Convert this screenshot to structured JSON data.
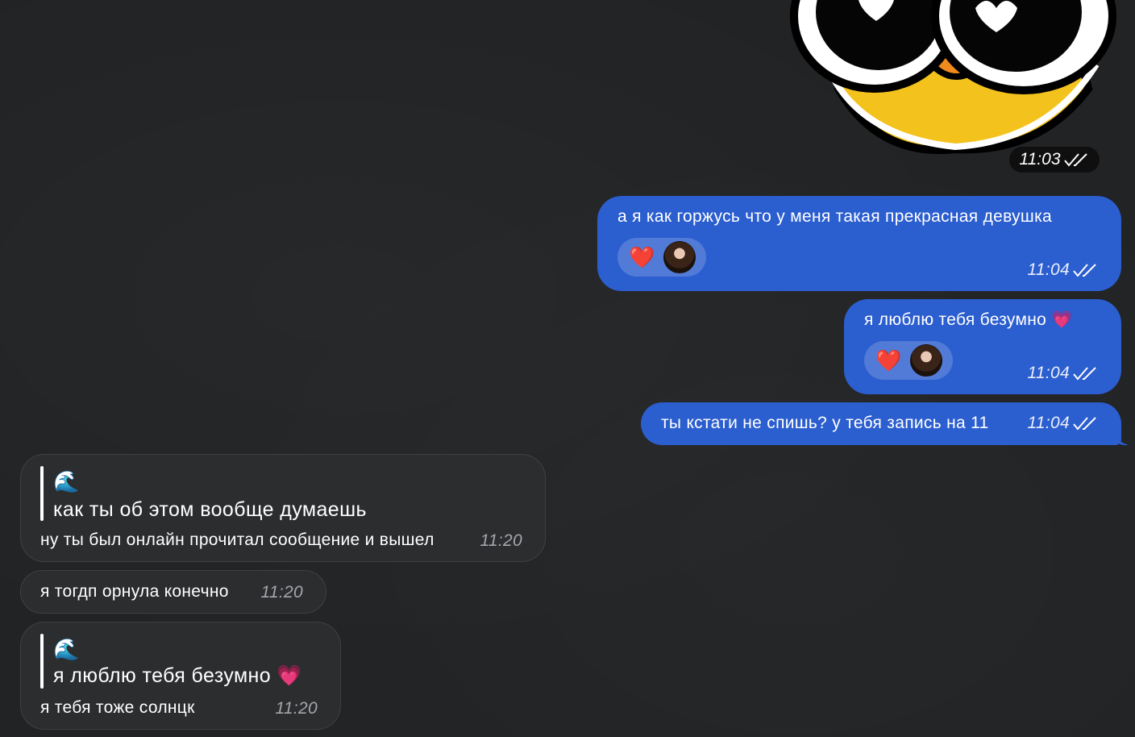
{
  "sticker": {
    "icon": "duck-with-heart-eyes-sticker",
    "time": "11:03"
  },
  "outgoing": [
    {
      "text": "а я как горжусь что у меня такая прекрасная девушка",
      "time": "11:04",
      "reaction": "❤️"
    },
    {
      "text": "я люблю тебя безумно 💗",
      "time": "11:04",
      "reaction": "❤️"
    },
    {
      "text": "ты кстати не спишь? у тебя запись на 11",
      "time": "11:04"
    }
  ],
  "incoming": [
    {
      "quote_emoji": "🌊",
      "quote_text": "как ты об этом вообще думаешь",
      "text": "ну ты был онлайн прочитал сообщение и вышел",
      "time": "11:20"
    },
    {
      "text": "я тогдп орнула конечно",
      "time": "11:20"
    },
    {
      "quote_emoji": "🌊",
      "quote_text": "я люблю тебя безумно 💗",
      "text": "я тебя тоже солнцк",
      "time": "11:20"
    }
  ],
  "colors": {
    "background": "#212325",
    "outgoing_bubble": "#2b5ecf",
    "incoming_bubble": "#2c2d2f"
  }
}
